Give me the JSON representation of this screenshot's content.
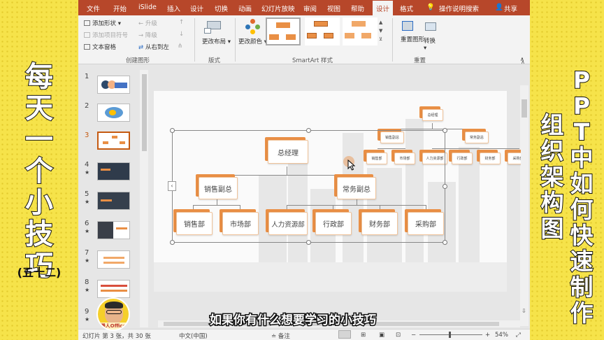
{
  "side": {
    "left_title": [
      "每",
      "天",
      "一",
      "个",
      "小",
      "技",
      "巧"
    ],
    "left_sub": "(五十二)",
    "right_col1": [
      "P",
      "P",
      "T",
      "中",
      "如",
      "何",
      "快",
      "速",
      "制",
      "作"
    ],
    "right_col2": [
      "组",
      "织",
      "架",
      "构",
      "图"
    ]
  },
  "tabs": [
    "文件",
    "开始",
    "iSlide",
    "插入",
    "设计",
    "切换",
    "动画",
    "幻灯片放映",
    "审阅",
    "视图",
    "帮助",
    "设计",
    "格式"
  ],
  "search_label": "操作说明搜索",
  "share_label": "共享",
  "ribbon": {
    "add_shape": "添加形状",
    "add_bullet": "添加项目符号",
    "text_pane": "文本窗格",
    "promote": "升级",
    "demote": "降级",
    "right_to_left": "从右到左",
    "group_create": "创建图形",
    "change_layout": "更改布局",
    "group_layout": "版式",
    "change_colors": "更改颜色",
    "group_styles": "SmartArt 样式",
    "reset_graphic": "重置图形",
    "convert": "转换",
    "group_reset": "重置"
  },
  "slides": [
    {
      "num": "1",
      "star": ""
    },
    {
      "num": "2",
      "star": ""
    },
    {
      "num": "3",
      "star": ""
    },
    {
      "num": "4",
      "star": "★"
    },
    {
      "num": "5",
      "star": "★"
    },
    {
      "num": "6",
      "star": "★"
    },
    {
      "num": "7",
      "star": "★"
    },
    {
      "num": "8",
      "star": "★"
    },
    {
      "num": "9",
      "star": "★"
    }
  ],
  "org": {
    "root": "总经理",
    "vp1": "销售副总",
    "vp2": "常务副总",
    "depts": [
      "销售部",
      "市场部",
      "人力资源部",
      "行政部",
      "财务部",
      "采购部"
    ]
  },
  "status": {
    "slide_info": "幻灯片 第 3 张，共 30 张",
    "language": "中文(中国)",
    "notes": "备注",
    "zoom": "54%"
  },
  "subtitle": "如果你有什么想要学习的小技巧",
  "logo_text": "懒人Office",
  "colors": {
    "accent": "#b7472a",
    "org_orange": "#e98f45",
    "yellow": "#f6e34a"
  }
}
